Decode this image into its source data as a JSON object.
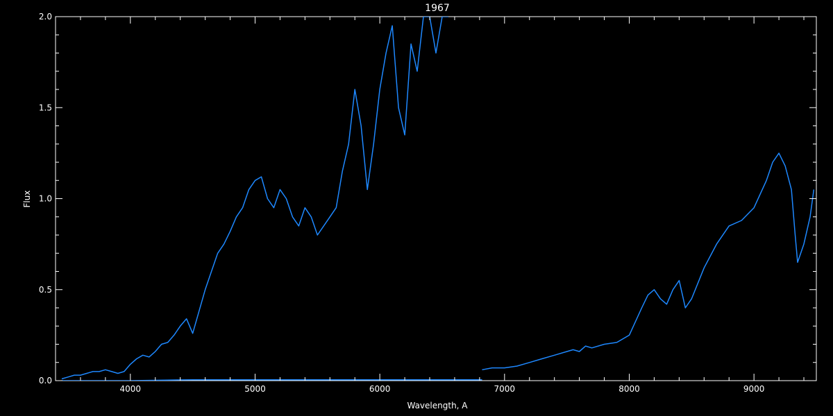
{
  "chart_data": {
    "type": "line",
    "title": "1967",
    "xlabel": "Wavelength, A",
    "ylabel": "Flux",
    "xlim": [
      3400,
      9500
    ],
    "ylim": [
      0,
      2.0
    ],
    "x_ticks": [
      4000,
      5000,
      6000,
      7000,
      8000,
      9000
    ],
    "x_tick_labels": [
      "4000",
      "5000",
      "6000",
      "7000",
      "8000",
      "9000"
    ],
    "y_ticks": [
      0,
      0.5,
      1.0,
      1.5,
      2.0
    ],
    "y_tick_labels": [
      "0.0",
      "0.5",
      "1.0",
      "1.5",
      "2.0"
    ],
    "grid": false,
    "colors": {
      "background": "#000000",
      "axes": "#ffffff",
      "series": "#1e88ff",
      "overlay": "#ffffff"
    },
    "series": [
      {
        "x": [
          3450,
          3500,
          3550,
          3600,
          3650,
          3700,
          3750,
          3800,
          3850,
          3900,
          3950,
          4000,
          4050,
          4100,
          4150,
          4200,
          4250,
          4300,
          4350,
          4400,
          4450,
          4500,
          4550,
          4600,
          4650,
          4700,
          4750,
          4800,
          4850,
          4900,
          4950,
          5000,
          5050,
          5100,
          5150,
          5200,
          5250,
          5300,
          5350,
          5400,
          5450,
          5500,
          5550,
          5600,
          5650,
          5700,
          5750,
          5800,
          5850,
          5900,
          5950,
          6000,
          6050,
          6100,
          6150,
          6200,
          6250,
          6300,
          6350,
          6400,
          6450,
          6500,
          6550
        ],
        "y": [
          0.01,
          0.02,
          0.03,
          0.03,
          0.04,
          0.05,
          0.05,
          0.06,
          0.05,
          0.04,
          0.05,
          0.09,
          0.12,
          0.14,
          0.13,
          0.16,
          0.2,
          0.21,
          0.25,
          0.3,
          0.34,
          0.26,
          0.38,
          0.5,
          0.6,
          0.7,
          0.75,
          0.82,
          0.9,
          0.95,
          1.05,
          1.1,
          1.12,
          1.0,
          0.95,
          1.05,
          1.0,
          0.9,
          0.85,
          0.95,
          0.9,
          0.8,
          0.85,
          0.9,
          0.95,
          1.15,
          1.3,
          1.6,
          1.4,
          1.05,
          1.3,
          1.6,
          1.8,
          1.95,
          1.5,
          1.35,
          1.85,
          1.7,
          2.0,
          2.0,
          1.8,
          2.0,
          2.0
        ]
      },
      {
        "x": [
          6820,
          6900,
          7000,
          7100,
          7200,
          7300,
          7400,
          7500,
          7550,
          7600,
          7650,
          7700,
          7800,
          7900,
          8000,
          8100,
          8150,
          8200,
          8250,
          8300,
          8350,
          8400,
          8450,
          8500,
          8600,
          8700,
          8800,
          8900,
          9000,
          9100,
          9150,
          9200,
          9250,
          9300,
          9330,
          9350,
          9400,
          9450,
          9480
        ],
        "y": [
          0.06,
          0.07,
          0.07,
          0.08,
          0.1,
          0.12,
          0.14,
          0.16,
          0.17,
          0.16,
          0.19,
          0.18,
          0.2,
          0.21,
          0.25,
          0.4,
          0.47,
          0.5,
          0.45,
          0.42,
          0.5,
          0.55,
          0.4,
          0.45,
          0.62,
          0.75,
          0.85,
          0.88,
          0.95,
          1.1,
          1.2,
          1.25,
          1.18,
          1.05,
          0.8,
          0.65,
          0.75,
          0.9,
          1.05
        ]
      },
      {
        "x": [
          3450,
          4000,
          4500,
          5000,
          5500,
          6000,
          6500,
          6820
        ],
        "y": [
          0.0,
          0.0,
          0.005,
          0.005,
          0.005,
          0.005,
          0.005,
          0.005
        ]
      }
    ]
  }
}
